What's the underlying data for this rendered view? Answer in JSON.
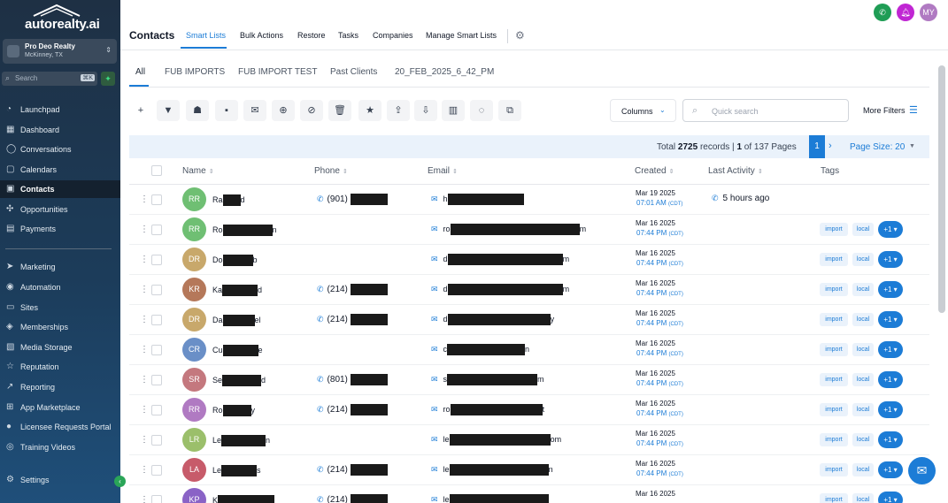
{
  "app": {
    "logo_text": "autorealty.ai",
    "account_name": "Pro Deo Realty",
    "account_location": "McKinney, TX",
    "search_placeholder": "Search",
    "search_shortcut": "⌘K"
  },
  "sidebar": {
    "items": [
      {
        "label": "Launchpad",
        "icon": "rocket-icon"
      },
      {
        "label": "Dashboard",
        "icon": "dashboard-icon"
      },
      {
        "label": "Conversations",
        "icon": "chat-icon"
      },
      {
        "label": "Calendars",
        "icon": "calendar-icon"
      },
      {
        "label": "Contacts",
        "icon": "contacts-icon",
        "active": true
      },
      {
        "label": "Opportunities",
        "icon": "opportunities-icon"
      },
      {
        "label": "Payments",
        "icon": "payments-icon"
      },
      {
        "label": "Marketing",
        "icon": "send-icon"
      },
      {
        "label": "Automation",
        "icon": "automation-icon"
      },
      {
        "label": "Sites",
        "icon": "sites-icon"
      },
      {
        "label": "Memberships",
        "icon": "membership-icon"
      },
      {
        "label": "Media Storage",
        "icon": "media-icon"
      },
      {
        "label": "Reputation",
        "icon": "star-icon"
      },
      {
        "label": "Reporting",
        "icon": "trend-icon"
      },
      {
        "label": "App Marketplace",
        "icon": "grid-icon"
      },
      {
        "label": "Licensee Requests Portal",
        "icon": "user-icon"
      },
      {
        "label": "Training Videos",
        "icon": "video-icon"
      },
      {
        "label": "Settings",
        "icon": "gear-icon"
      }
    ]
  },
  "header": {
    "title": "Contacts",
    "tabs": [
      "Smart Lists",
      "Bulk Actions",
      "Restore",
      "Tasks",
      "Companies",
      "Manage Smart Lists"
    ],
    "user_initials": "MY"
  },
  "filter_tabs": [
    "All",
    "FUB IMPORTS",
    "FUB IMPORT TEST",
    "Past Clients",
    "20_FEB_2025_6_42_PM"
  ],
  "toolbar": {
    "columns_label": "Columns",
    "search_placeholder": "Quick search",
    "more_filters_label": "More Filters"
  },
  "pagination": {
    "total_label": "Total",
    "total": "2725",
    "records_label": "records |",
    "page": "1",
    "of_label": "of 137 Pages",
    "current_page": "1",
    "page_size_label": "Page Size: 20"
  },
  "table": {
    "columns": [
      "Name",
      "Phone",
      "Email",
      "Created",
      "Last Activity",
      "Tags"
    ],
    "rows": [
      {
        "initials": "RR",
        "name_prefix": "Ra",
        "name_suffix": "d",
        "phone": "(901)",
        "email_prefix": "h",
        "email_suffix": "",
        "date": "Mar 19 2025",
        "time": "07:01 AM",
        "tz": "(CDT)",
        "activity": "5 hours ago",
        "tags": []
      },
      {
        "initials": "RR",
        "name_prefix": "Ro",
        "name_suffix": "n",
        "phone": "",
        "email_prefix": "ro",
        "email_suffix": "m",
        "date": "Mar 16 2025",
        "time": "07:44 PM",
        "tz": "(CDT)",
        "activity": "",
        "tags": [
          "import",
          "local",
          "+1"
        ]
      },
      {
        "initials": "DR",
        "name_prefix": "Do",
        "name_suffix": "b",
        "phone": "",
        "email_prefix": "d",
        "email_suffix": "m",
        "date": "Mar 16 2025",
        "time": "07:44 PM",
        "tz": "(CDT)",
        "activity": "",
        "tags": [
          "import",
          "local",
          "+1"
        ]
      },
      {
        "initials": "KR",
        "name_prefix": "Ka",
        "name_suffix": "d",
        "phone": "(214)",
        "email_prefix": "d",
        "email_suffix": "m",
        "date": "Mar 16 2025",
        "time": "07:44 PM",
        "tz": "(CDT)",
        "activity": "",
        "tags": [
          "import",
          "local",
          "+1"
        ]
      },
      {
        "initials": "DR",
        "name_prefix": "Da",
        "name_suffix": "el",
        "phone": "(214)",
        "email_prefix": "d",
        "email_suffix": "y",
        "date": "Mar 16 2025",
        "time": "07:44 PM",
        "tz": "(CDT)",
        "activity": "",
        "tags": [
          "import",
          "local",
          "+1"
        ]
      },
      {
        "initials": "CR",
        "name_prefix": "Cu",
        "name_suffix": "e",
        "phone": "",
        "email_prefix": "c",
        "email_suffix": "n",
        "date": "Mar 16 2025",
        "time": "07:44 PM",
        "tz": "(CDT)",
        "activity": "",
        "tags": [
          "import",
          "local",
          "+1"
        ]
      },
      {
        "initials": "SR",
        "name_prefix": "Se",
        "name_suffix": "d",
        "phone": "(801)",
        "email_prefix": "s",
        "email_suffix": "m",
        "date": "Mar 16 2025",
        "time": "07:44 PM",
        "tz": "(CDT)",
        "activity": "",
        "tags": [
          "import",
          "local",
          "+1"
        ]
      },
      {
        "initials": "RR",
        "name_prefix": "Ro",
        "name_suffix": "y",
        "phone": "(214)",
        "email_prefix": "ro",
        "email_suffix": "t",
        "date": "Mar 16 2025",
        "time": "07:44 PM",
        "tz": "(CDT)",
        "activity": "",
        "tags": [
          "import",
          "local",
          "+1"
        ]
      },
      {
        "initials": "LR",
        "name_prefix": "Le",
        "name_suffix": "n",
        "phone": "",
        "email_prefix": "le",
        "email_suffix": "om",
        "date": "Mar 16 2025",
        "time": "07:44 PM",
        "tz": "(CDT)",
        "activity": "",
        "tags": [
          "import",
          "local",
          "+1"
        ]
      },
      {
        "initials": "LA",
        "name_prefix": "Le",
        "name_suffix": "s",
        "phone": "(214)",
        "email_prefix": "le",
        "email_suffix": "n",
        "date": "Mar 16 2025",
        "time": "07:44 PM",
        "tz": "(CDT)",
        "activity": "",
        "tags": [
          "import",
          "local",
          "+1"
        ]
      },
      {
        "initials": "KP",
        "name_prefix": "K",
        "name_suffix": "",
        "phone": "(214)",
        "email_prefix": "le",
        "email_suffix": "",
        "date": "Mar 16 2025",
        "time": "",
        "tz": "",
        "activity": "",
        "tags": [
          "import",
          "local",
          "+1"
        ]
      }
    ]
  },
  "colors": {
    "accent": "#1c7cd6",
    "avatar_green": "#6fbf73",
    "avatar_tan": "#c8a86b",
    "avatar_brown": "#b5785a",
    "avatar_blue": "#6a8fc7",
    "avatar_rose": "#c4787e",
    "avatar_purple": "#b07ac2",
    "avatar_pink": "#c75b6a",
    "avatar_lime": "#9bbf6b",
    "avatar_violet": "#8a63c6"
  }
}
